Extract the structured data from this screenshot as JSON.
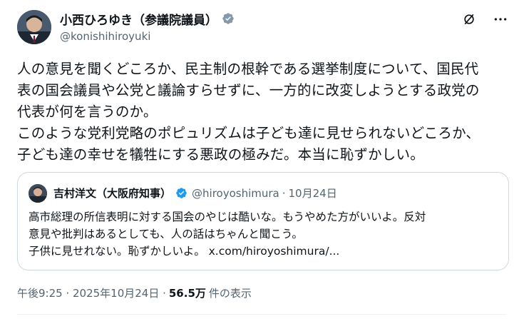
{
  "author": {
    "name": "小西ひろゆき（参議院議員）",
    "handle": "@konishihiroyuki"
  },
  "tweet": {
    "text": "人の意見を聞くどころか、民主制の根幹である選挙制度について、国民代\n表の国会議員や公党と議論すらせずに、一方的に改変しようとする政党の\n代表が何を言うのか。\nこのような党利党略のポピュリズムは子ども達に見せられないどころか、\n子ども達の幸せを犠牲にする悪政の極みだ。本当に恥ずかしい。"
  },
  "quote": {
    "name": "吉村洋文（大阪府知事）",
    "handle": "@hiroyoshimura",
    "separator": "·",
    "date": "10月24日",
    "text": "高市総理の所信表明に対する国会のやじは酷いな。もうやめた方がいいよ。反対\n意見や批判はあるとしても、人の話はちゃんと聞こう。\n子供に見せれない。恥ずかしいよ。 x.com/hiroyoshimura/..."
  },
  "footer": {
    "timestamp": "午後9:25 · 2025年10月24日 ·",
    "views": "56.5万",
    "views_label": "件の表示"
  },
  "icons": {
    "verified": "verified-badge-icon",
    "grok": "grok-icon",
    "more": "more-icon"
  },
  "colors": {
    "verified": "#1d9bf0",
    "secondary_text": "#536471",
    "border": "#cfd9de"
  }
}
